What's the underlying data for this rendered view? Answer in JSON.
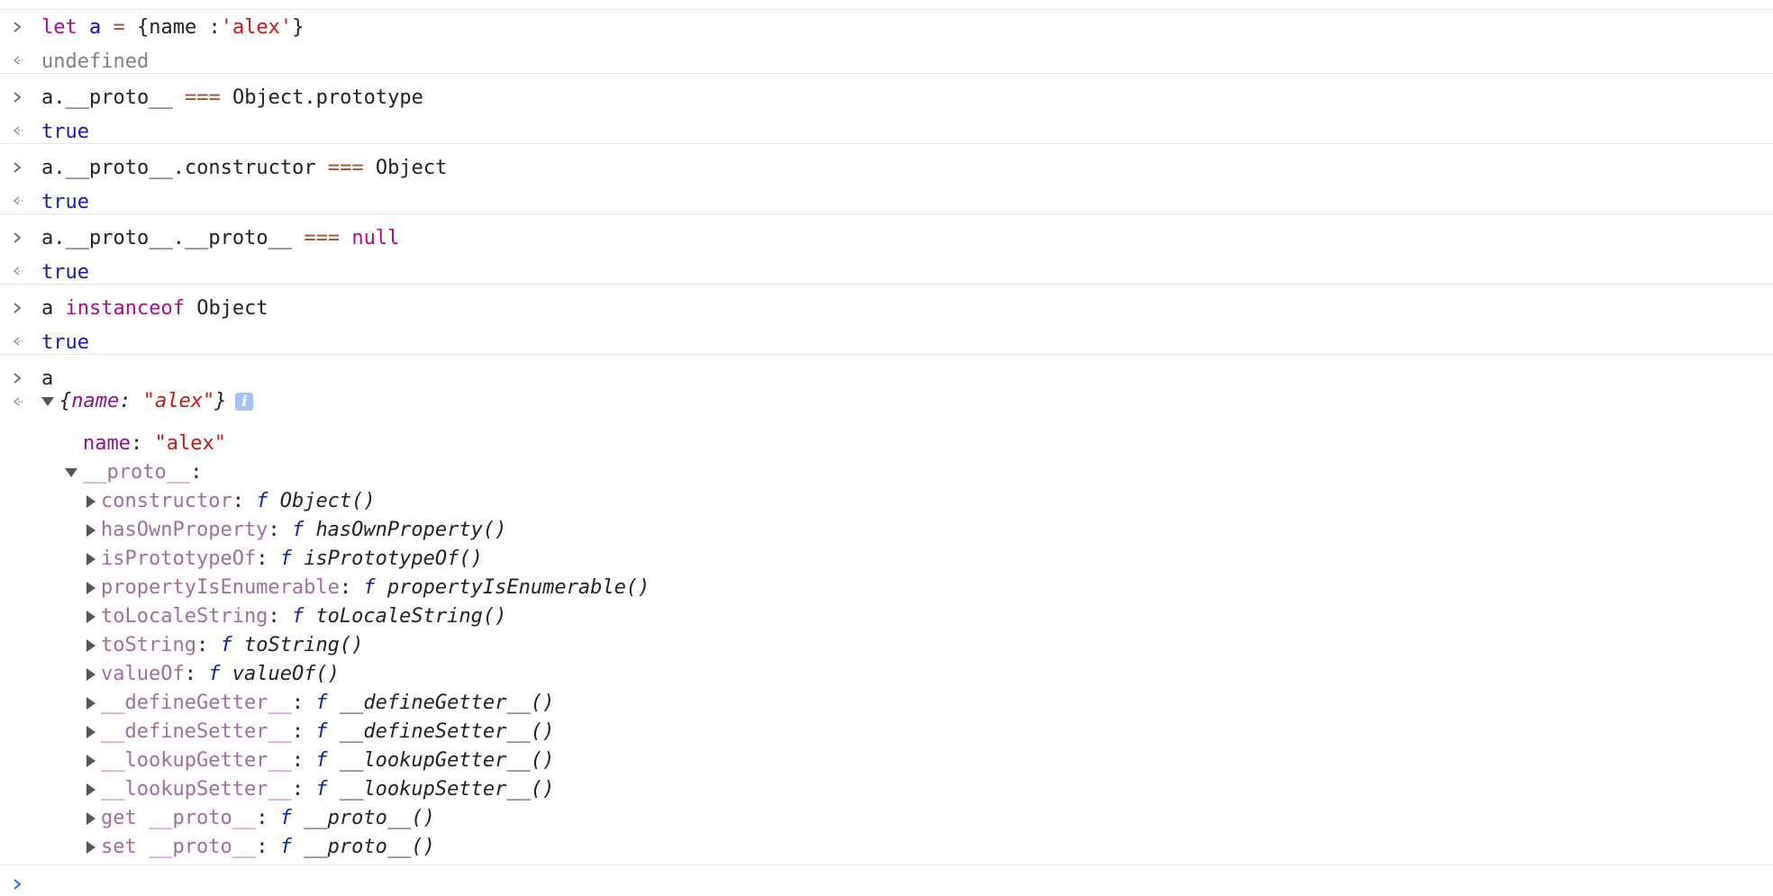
{
  "history": [
    {
      "input": [
        [
          "kw",
          "let "
        ],
        [
          "varb",
          "a"
        ],
        [
          "op",
          " = "
        ],
        [
          "plain",
          "{name :"
        ],
        [
          "str",
          "'alex'"
        ],
        [
          "plain",
          "}"
        ]
      ],
      "output": "undefined",
      "output_class": "undef"
    },
    {
      "input": [
        [
          "plain",
          "a.__proto__ "
        ],
        [
          "op",
          "==="
        ],
        [
          "plain",
          " Object.prototype"
        ]
      ],
      "output": "true",
      "output_class": "bool"
    },
    {
      "input": [
        [
          "plain",
          "a.__proto__.constructor "
        ],
        [
          "op",
          "==="
        ],
        [
          "plain",
          " Object"
        ]
      ],
      "output": "true",
      "output_class": "bool"
    },
    {
      "input": [
        [
          "plain",
          "a.__proto__.__proto__ "
        ],
        [
          "op",
          "==="
        ],
        [
          "kw",
          " null"
        ]
      ],
      "output": "true",
      "output_class": "bool"
    },
    {
      "input": [
        [
          "plain",
          "a "
        ],
        [
          "kw",
          "instanceof"
        ],
        [
          "plain",
          " Object"
        ]
      ],
      "output": "true",
      "output_class": "bool"
    },
    {
      "input": [
        [
          "plain",
          "a"
        ]
      ]
    }
  ],
  "object_preview": {
    "open_brace": "{",
    "key": "name",
    "colon": ": ",
    "value": "\"alex\"",
    "close_brace": "}",
    "info_glyph": "i"
  },
  "own_property": {
    "name": "name",
    "value": "\"alex\""
  },
  "proto_label": "__proto__",
  "proto_members": [
    {
      "name": "constructor",
      "fn": "Object()"
    },
    {
      "name": "hasOwnProperty",
      "fn": "hasOwnProperty()"
    },
    {
      "name": "isPrototypeOf",
      "fn": "isPrototypeOf()"
    },
    {
      "name": "propertyIsEnumerable",
      "fn": "propertyIsEnumerable()"
    },
    {
      "name": "toLocaleString",
      "fn": "toLocaleString()"
    },
    {
      "name": "toString",
      "fn": "toString()"
    },
    {
      "name": "valueOf",
      "fn": "valueOf()"
    },
    {
      "name": "__defineGetter__",
      "fn": "__defineGetter__()"
    },
    {
      "name": "__defineSetter__",
      "fn": "__defineSetter__()"
    },
    {
      "name": "__lookupGetter__",
      "fn": "__lookupGetter__()"
    },
    {
      "name": "__lookupSetter__",
      "fn": "__lookupSetter__()"
    },
    {
      "name": "get __proto__",
      "fn": "__proto__()"
    },
    {
      "name": "set __proto__",
      "fn": "__proto__()"
    }
  ],
  "function_glyph": "f",
  "colors": {
    "accent": "#1a73e8",
    "separator": "#e6e6e6"
  }
}
